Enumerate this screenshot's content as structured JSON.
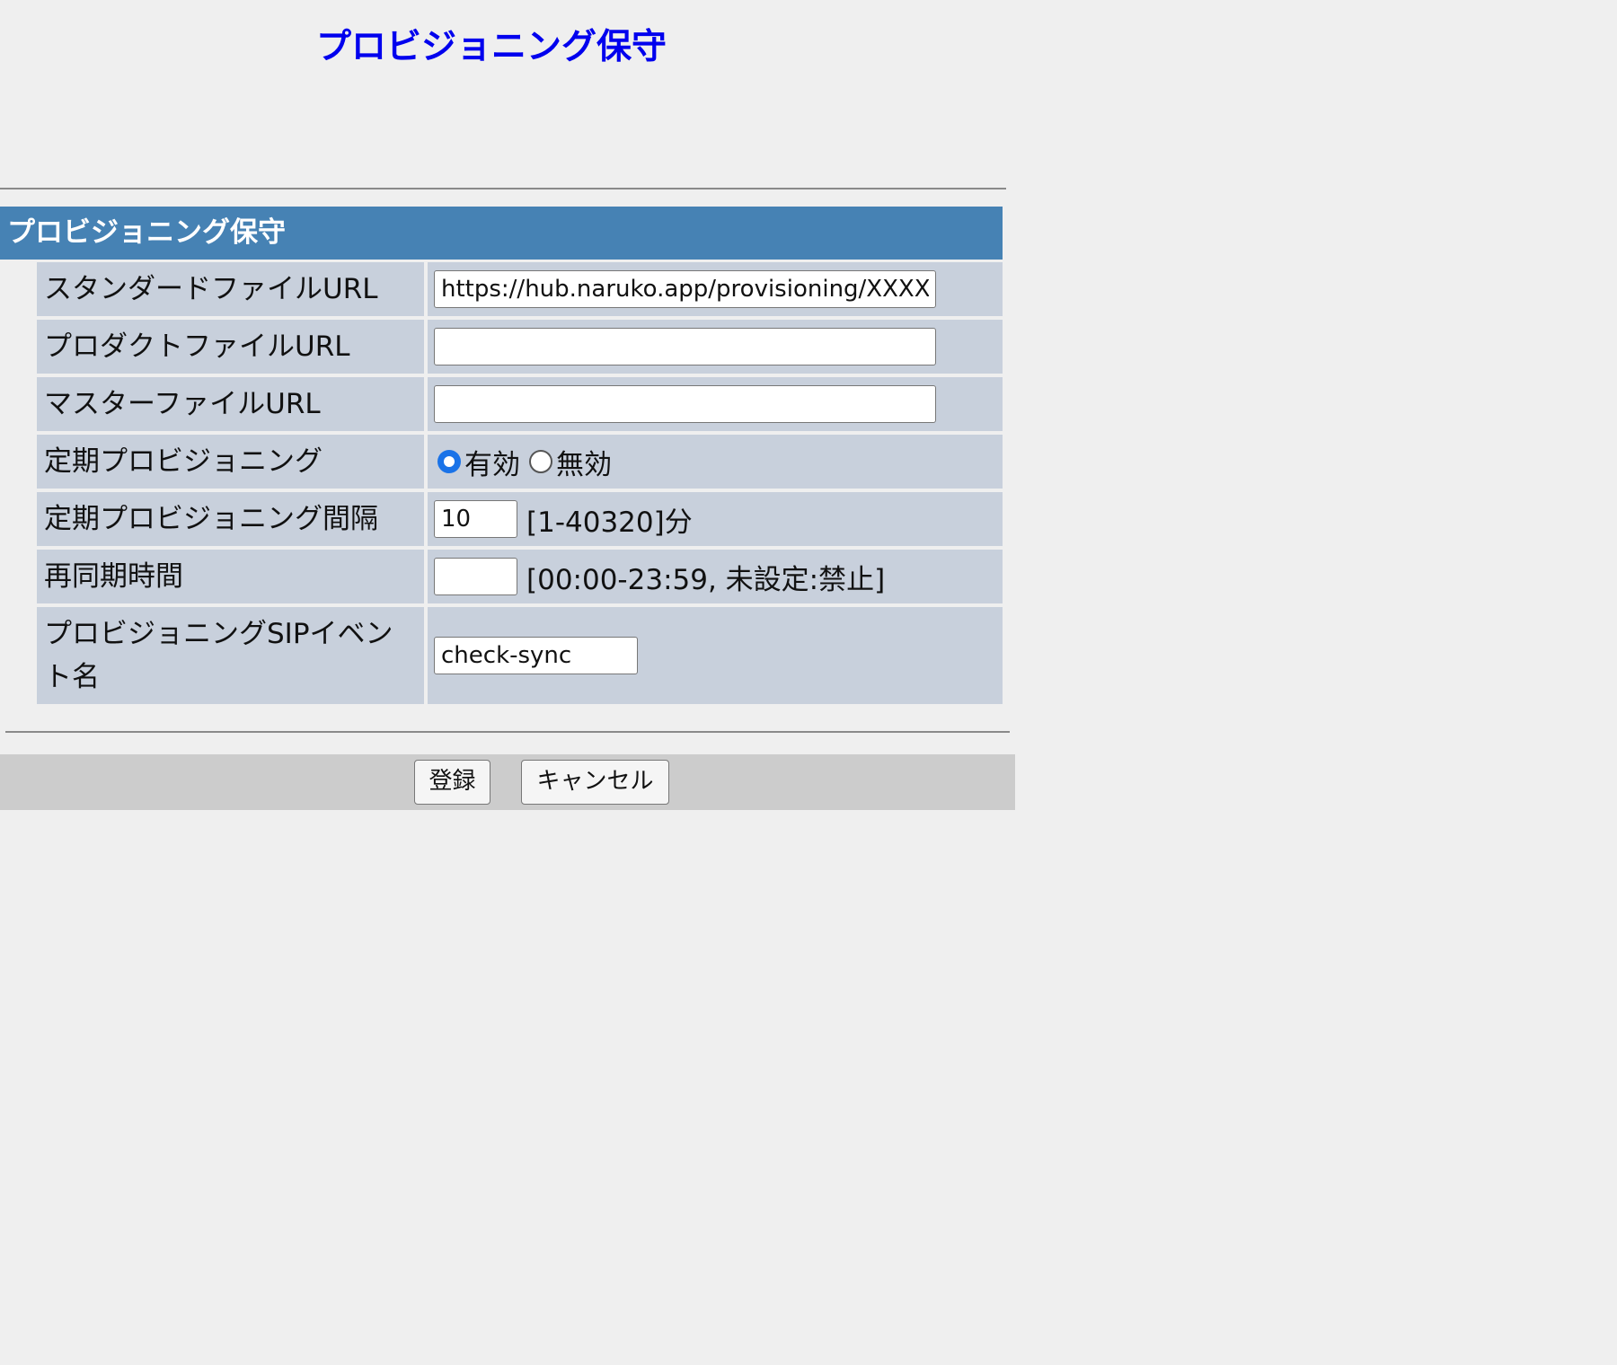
{
  "page": {
    "title": "プロビジョニング保守"
  },
  "section": {
    "header": "プロビジョニング保守"
  },
  "form": {
    "standard_url": {
      "label": "スタンダードファイルURL",
      "value": "https://hub.naruko.app/provisioning/XXXXXXX"
    },
    "product_url": {
      "label": "プロダクトファイルURL",
      "value": ""
    },
    "master_url": {
      "label": "マスターファイルURL",
      "value": ""
    },
    "periodic": {
      "label": "定期プロビジョニング",
      "options": [
        "有効",
        "無効"
      ],
      "selected": "有効"
    },
    "interval": {
      "label": "定期プロビジョニング間隔",
      "value": "10",
      "hint": "[1-40320]分"
    },
    "resync_time": {
      "label": "再同期時間",
      "value": "",
      "hint": "[00:00-23:59, 未設定:禁止]"
    },
    "sip_event": {
      "label": "プロビジョニングSIPイベント名",
      "value": "check-sync"
    }
  },
  "buttons": {
    "submit": "登録",
    "cancel": "キャンセル"
  },
  "colors": {
    "title": "#0000ee",
    "section_header_bg": "#4682b4",
    "cell_bg": "#c8d0dc",
    "page_bg": "#efefef",
    "button_bar_bg": "#cccccc",
    "radio_accent": "#1a73e8"
  }
}
